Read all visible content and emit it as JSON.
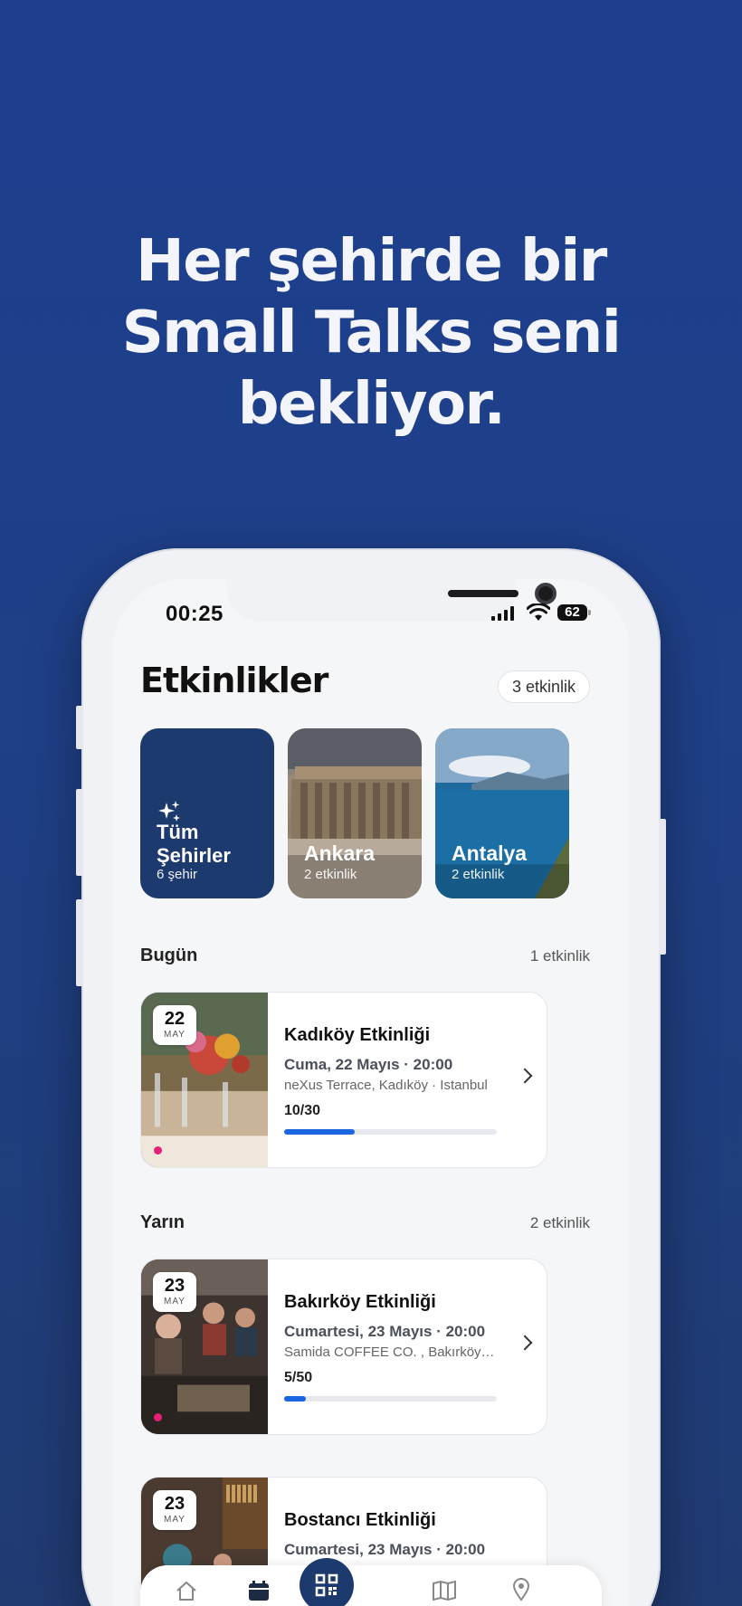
{
  "headline": {
    "line1": "Her şehirde bir",
    "line2": "Small Talks seni",
    "line3": "bekliyor."
  },
  "status_bar": {
    "time": "00:25",
    "battery": "62"
  },
  "page": {
    "title": "Etkinlikler",
    "count_pill": "3 etkinlik"
  },
  "cities": [
    {
      "name_line1": "Tüm",
      "name_line2": "Şehirler",
      "count": "6 şehir",
      "icon": "sparkles-icon"
    },
    {
      "name": "Ankara",
      "count": "2 etkinlik"
    },
    {
      "name": "Antalya",
      "count": "2 etkinlik"
    }
  ],
  "sections": [
    {
      "label": "Bugün",
      "count": "1 etkinlik"
    },
    {
      "label": "Yarın",
      "count": "2 etkinlik"
    }
  ],
  "events": [
    {
      "day": "22",
      "month": "MAY",
      "title": "Kadıköy Etkinliği",
      "date": "Cuma, 22 Mayıs · 20:00",
      "location": "neXus Terrace, Kadıköy · Istanbul",
      "capacity": "10/30",
      "fill_percent": 33
    },
    {
      "day": "23",
      "month": "MAY",
      "title": "Bakırköy Etkinliği",
      "date": "Cumartesi, 23 Mayıs · 20:00",
      "location": "Samida COFFEE CO. , Bakırköy…",
      "capacity": "5/50",
      "fill_percent": 10
    },
    {
      "day": "23",
      "month": "MAY",
      "title": "Bostancı Etkinliği",
      "date": "Cumartesi, 23 Mayıs · 20:00"
    }
  ],
  "tabbar": {
    "items": [
      "home-icon",
      "calendar-icon",
      "qr-code-icon",
      "map-icon",
      "location-pin-icon"
    ],
    "active": "calendar-icon"
  },
  "colors": {
    "background": "#1f3f86",
    "accent": "#1a66e0",
    "city_all": "#1d3a6e",
    "live_dot": "#e91e78"
  }
}
